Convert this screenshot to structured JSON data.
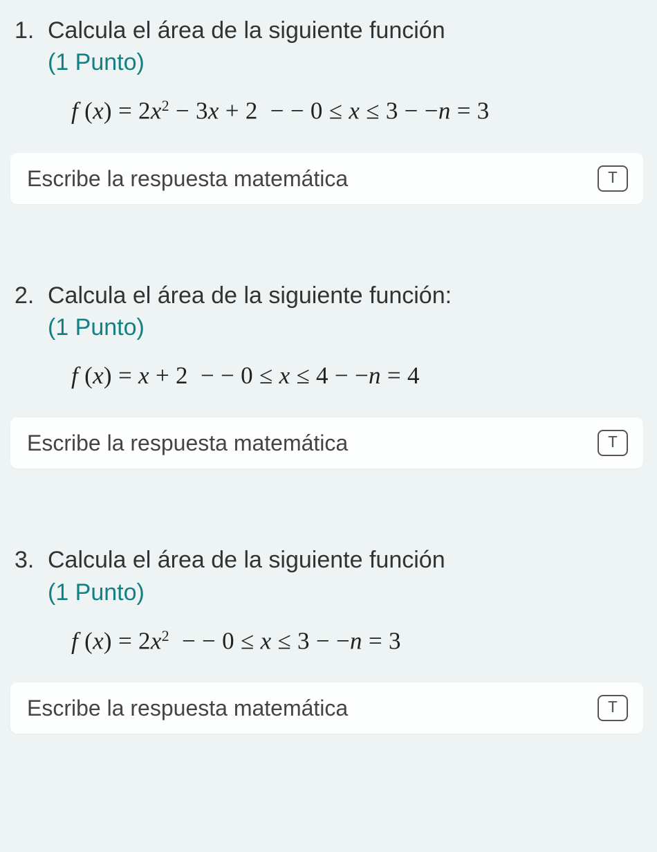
{
  "questions": [
    {
      "number": "1.",
      "title": "Calcula el área de la siguiente función",
      "points": "(1 Punto)",
      "equation_html": "<span style='font-style:italic'>f</span> <span class='up'>(</span><span>x</span><span class='up'>)</span> <span class='up'>=</span> <span class='up'>2</span><span>x</span><sup class='up'>2</sup> <span class='up'>&minus;</span> <span class='up'>3</span><span>x</span> <span class='up'>+ 2</span>&nbsp; <span class='up'>&minus; &minus; 0 &le;</span> <span>x</span> <span class='up'>&le; 3 &minus; &minus;</span><span>n</span> <span class='up'>= 3</span>",
      "placeholder": "Escribe la respuesta matemática",
      "button": "T"
    },
    {
      "number": "2.",
      "title": "Calcula el área de la siguiente función:",
      "points": "(1 Punto)",
      "equation_html": "<span style='font-style:italic'>f</span> <span class='up'>(</span><span>x</span><span class='up'>)</span> <span class='up'>=</span> <span>x</span> <span class='up'>+ 2</span>&nbsp; <span class='up'>&minus; &minus; 0 &le;</span> <span>x</span> <span class='up'>&le; 4 &minus; &minus;</span><span>n</span> <span class='up'>= 4</span>",
      "placeholder": "Escribe la respuesta matemática",
      "button": "T"
    },
    {
      "number": "3.",
      "title": "Calcula el área de la siguiente función",
      "points": "(1 Punto)",
      "equation_html": "<span style='font-style:italic'>f</span> <span class='up'>(</span><span>x</span><span class='up'>)</span> <span class='up'>=</span> <span class='up'>2</span><span>x</span><sup class='up'>2</sup>&nbsp; <span class='up'>&minus; &minus; 0 &le;</span> <span>x</span> <span class='up'>&le; 3 &minus; &minus;</span><span>n</span> <span class='up'>= 3</span>",
      "placeholder": "Escribe la respuesta matemática",
      "button": "T"
    }
  ]
}
